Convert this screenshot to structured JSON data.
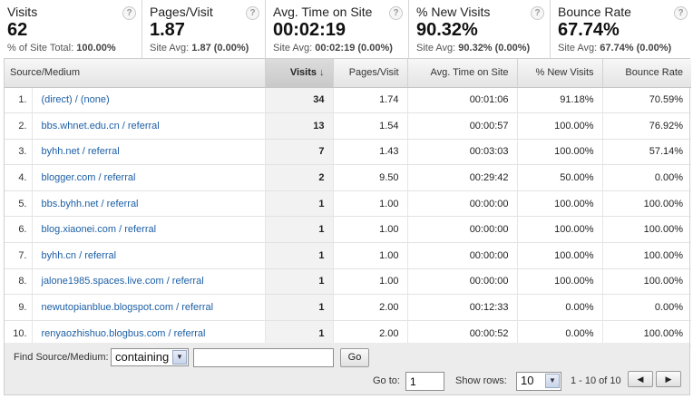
{
  "scorecards": [
    {
      "label": "Visits",
      "value": "62",
      "sub_prefix": "% of Site Total: ",
      "sub_value": "100.00%"
    },
    {
      "label": "Pages/Visit",
      "value": "1.87",
      "sub_prefix": "Site Avg: ",
      "sub_value": "1.87 (0.00%)"
    },
    {
      "label": "Avg. Time on Site",
      "value": "00:02:19",
      "sub_prefix": "Site Avg: ",
      "sub_value": "00:02:19 (0.00%)"
    },
    {
      "label": "% New Visits",
      "value": "90.32%",
      "sub_prefix": "Site Avg: ",
      "sub_value": "90.32% (0.00%)"
    },
    {
      "label": "Bounce Rate",
      "value": "67.74%",
      "sub_prefix": "Site Avg: ",
      "sub_value": "67.74% (0.00%)"
    }
  ],
  "help_glyph": "?",
  "table": {
    "headers": {
      "source": "Source/Medium",
      "visits": "Visits",
      "pages": "Pages/Visit",
      "time": "Avg. Time on Site",
      "new": "% New Visits",
      "bounce": "Bounce Rate"
    },
    "sort_arrow": "↓",
    "rows": [
      {
        "n": "1.",
        "source": "(direct) / (none)",
        "visits": "34",
        "pages": "1.74",
        "time": "00:01:06",
        "new": "91.18%",
        "bounce": "70.59%"
      },
      {
        "n": "2.",
        "source": "bbs.whnet.edu.cn / referral",
        "visits": "13",
        "pages": "1.54",
        "time": "00:00:57",
        "new": "100.00%",
        "bounce": "76.92%"
      },
      {
        "n": "3.",
        "source": "byhh.net / referral",
        "visits": "7",
        "pages": "1.43",
        "time": "00:03:03",
        "new": "100.00%",
        "bounce": "57.14%"
      },
      {
        "n": "4.",
        "source": "blogger.com / referral",
        "visits": "2",
        "pages": "9.50",
        "time": "00:29:42",
        "new": "50.00%",
        "bounce": "0.00%"
      },
      {
        "n": "5.",
        "source": "bbs.byhh.net / referral",
        "visits": "1",
        "pages": "1.00",
        "time": "00:00:00",
        "new": "100.00%",
        "bounce": "100.00%"
      },
      {
        "n": "6.",
        "source": "blog.xiaonei.com / referral",
        "visits": "1",
        "pages": "1.00",
        "time": "00:00:00",
        "new": "100.00%",
        "bounce": "100.00%"
      },
      {
        "n": "7.",
        "source": "byhh.cn / referral",
        "visits": "1",
        "pages": "1.00",
        "time": "00:00:00",
        "new": "100.00%",
        "bounce": "100.00%"
      },
      {
        "n": "8.",
        "source": "jalone1985.spaces.live.com / referral",
        "visits": "1",
        "pages": "1.00",
        "time": "00:00:00",
        "new": "100.00%",
        "bounce": "100.00%"
      },
      {
        "n": "9.",
        "source": "newutopianblue.blogspot.com / referral",
        "visits": "1",
        "pages": "2.00",
        "time": "00:12:33",
        "new": "0.00%",
        "bounce": "0.00%"
      },
      {
        "n": "10.",
        "source": "renyaozhishuo.blogbus.com / referral",
        "visits": "1",
        "pages": "2.00",
        "time": "00:00:52",
        "new": "0.00%",
        "bounce": "100.00%"
      }
    ]
  },
  "footer": {
    "find_label": "Find Source/Medium:",
    "match_select": "containing",
    "find_value": "",
    "go_button": "Go",
    "goto_label": "Go to:",
    "goto_value": "1",
    "show_rows_label": "Show rows:",
    "show_rows_value": "10",
    "range_text": "1 - 10 of 10",
    "prev_glyph": "◀",
    "next_glyph": "▶",
    "dropdown_glyph": "▼"
  },
  "colors": {
    "link": "#1d5fa6",
    "sorted_header": "#c9c9c9",
    "footer_bg": "#ececec"
  }
}
